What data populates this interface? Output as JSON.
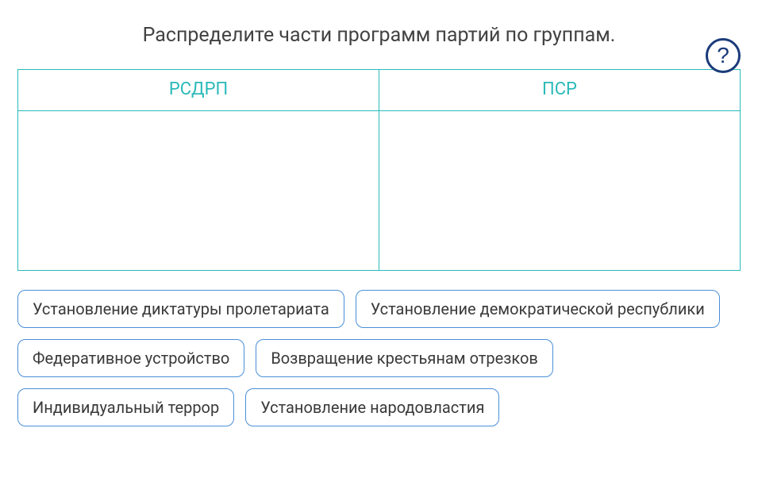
{
  "instruction": "Распределите части программ партий по группам.",
  "help_label": "?",
  "columns": [
    {
      "title": "РСДРП"
    },
    {
      "title": "ПСР"
    }
  ],
  "chips": [
    "Установление диктатуры пролетариата",
    "Установление демократической республики",
    "Федеративное устройство",
    "Возвращение крестьянам отрезков",
    "Индивидуальный террор",
    "Установление народовластия"
  ]
}
